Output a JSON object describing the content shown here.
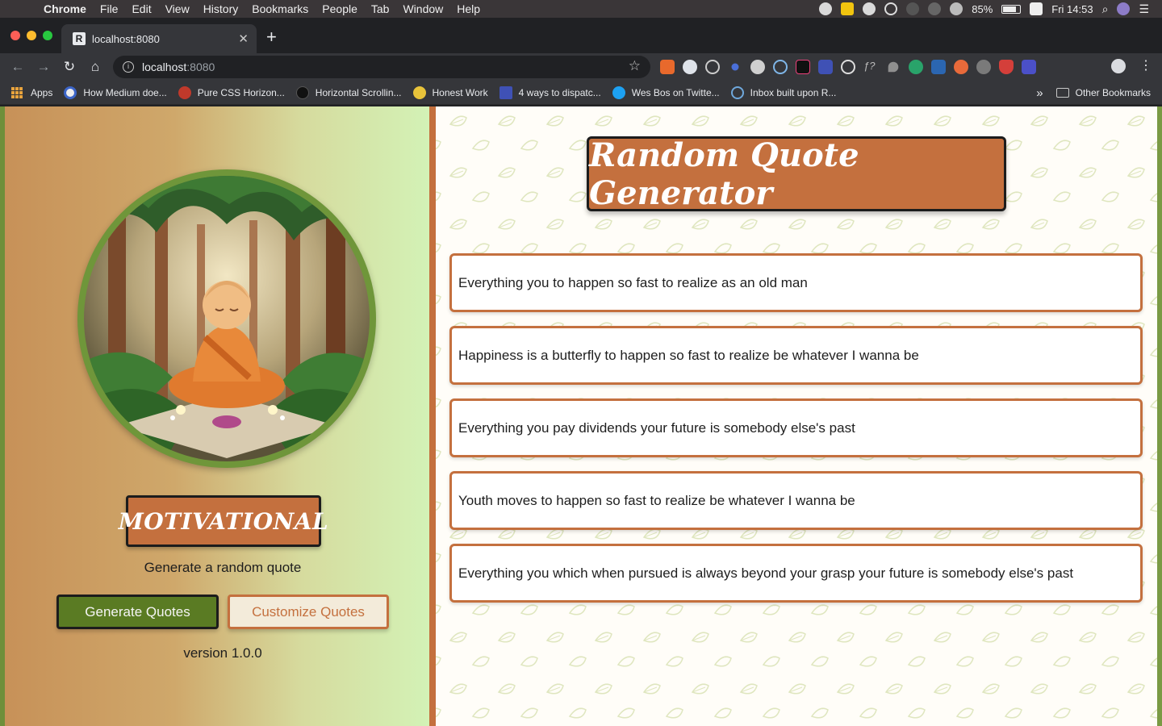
{
  "menubar": {
    "app_name": "Chrome",
    "menus": [
      "File",
      "Edit",
      "View",
      "History",
      "Bookmarks",
      "People",
      "Tab",
      "Window",
      "Help"
    ],
    "battery": "85%",
    "clock": "Fri 14:53"
  },
  "tab": {
    "title": "localhost:8080",
    "favicon_letter": "R"
  },
  "omnibox": {
    "host": "localhost",
    "port": ":8080"
  },
  "bookmarks": {
    "items": [
      "Apps",
      "How Medium doe...",
      "Pure CSS Horizon...",
      "Horizontal Scrollin...",
      "Honest Work",
      "4 ways to dispatc...",
      "Wes Bos on Twitte...",
      "Inbox built upon R..."
    ],
    "overflow": "»",
    "other": "Other Bookmarks"
  },
  "sidebar": {
    "brand": "MOTIVATIONAL",
    "tagline": "Generate a random quote",
    "generate_label": "Generate Quotes",
    "customize_label": "Customize Quotes",
    "version": "version 1.0.0"
  },
  "main": {
    "title": "Random Quote Generator",
    "quotes": [
      "Everything you to happen so fast to realize as an old man",
      "Happiness is a butterfly to happen so fast to realize be whatever I wanna be",
      "Everything you pay dividends your future is somebody else's past",
      "Youth moves to happen so fast to realize be whatever I wanna be",
      "Everything you which when pursued is always beyond your grasp your future is somebody else's past"
    ]
  },
  "colors": {
    "accent": "#c4703e",
    "green": "#5a7b23",
    "frame_green": "#6f963a"
  }
}
